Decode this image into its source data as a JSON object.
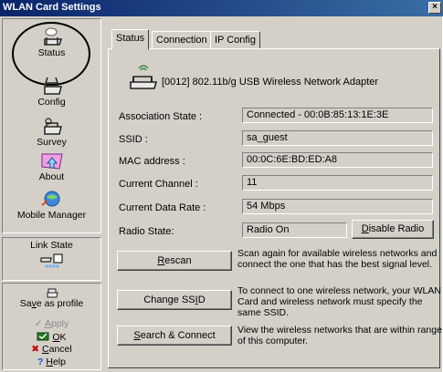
{
  "window": {
    "title": "WLAN Card Settings",
    "close_label": "×"
  },
  "nav": {
    "items": [
      {
        "label": "Status"
      },
      {
        "label": "Config"
      },
      {
        "label": "Survey"
      },
      {
        "label": "About"
      },
      {
        "label": "Mobile Manager"
      }
    ],
    "link_state_label": "Link State"
  },
  "actions": {
    "save_pre": "Sa",
    "save_u": "v",
    "save_post": "e as profile",
    "apply_u": "A",
    "apply_post": "pply",
    "ok_u": "O",
    "ok_post": "K",
    "cancel_u": "C",
    "cancel_post": "ancel",
    "help_u": "H",
    "help_post": "elp"
  },
  "tabs": [
    {
      "label": "Status",
      "active": true
    },
    {
      "label": "Connection",
      "active": false
    },
    {
      "label": "IP Config",
      "active": false
    }
  ],
  "adapter": {
    "name": "[0012] 802.11b/g USB Wireless Network Adapter",
    "icon": "usb-wireless-adapter-icon"
  },
  "status": {
    "association_label": "Association State :",
    "association_value": "Connected - 00:0B:85:13:1E:3E",
    "ssid_label": "SSID :",
    "ssid_value": "sa_guest",
    "mac_label": "MAC address :",
    "mac_value": "00:0C:6E:BD:ED:A8",
    "channel_label": "Current Channel :",
    "channel_value": "11",
    "rate_label": "Current Data Rate :",
    "rate_value": "54 Mbps",
    "radio_label": "Radio State:",
    "radio_value": "Radio On"
  },
  "buttons": {
    "disable_radio_u": "D",
    "disable_radio_post": "isable Radio",
    "rescan_u": "R",
    "rescan_post": "escan",
    "change_ssid_pre": "Change SS",
    "change_ssid_u": "I",
    "change_ssid_post": "D",
    "search_u": "S",
    "search_post": "earch & Connect"
  },
  "descriptions": {
    "rescan": "Scan again for available wireless networks and connect the one that has the best signal level.",
    "change_ssid": "To connect to one wireless network, your WLAN Card and wireless network must specify the same SSID.",
    "search": "View the wireless networks that are within range of this computer."
  },
  "colors": {
    "titlebar": "#0a246a",
    "face": "#d4d0c8",
    "highlight_circle": "#000000",
    "cancel_x": "#cc0000",
    "help_q": "#1f4fd0"
  }
}
